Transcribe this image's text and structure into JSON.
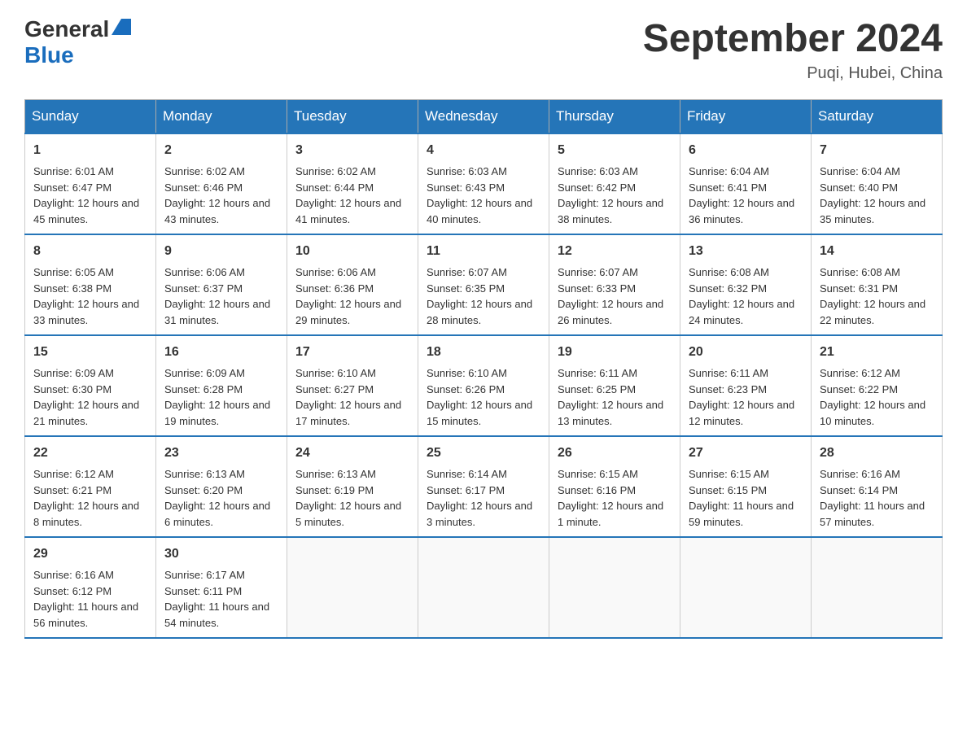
{
  "header": {
    "logo_general": "General",
    "logo_blue": "Blue",
    "title": "September 2024",
    "subtitle": "Puqi, Hubei, China"
  },
  "calendar": {
    "weekdays": [
      "Sunday",
      "Monday",
      "Tuesday",
      "Wednesday",
      "Thursday",
      "Friday",
      "Saturday"
    ],
    "weeks": [
      [
        {
          "day": "1",
          "sunrise": "Sunrise: 6:01 AM",
          "sunset": "Sunset: 6:47 PM",
          "daylight": "Daylight: 12 hours and 45 minutes."
        },
        {
          "day": "2",
          "sunrise": "Sunrise: 6:02 AM",
          "sunset": "Sunset: 6:46 PM",
          "daylight": "Daylight: 12 hours and 43 minutes."
        },
        {
          "day": "3",
          "sunrise": "Sunrise: 6:02 AM",
          "sunset": "Sunset: 6:44 PM",
          "daylight": "Daylight: 12 hours and 41 minutes."
        },
        {
          "day": "4",
          "sunrise": "Sunrise: 6:03 AM",
          "sunset": "Sunset: 6:43 PM",
          "daylight": "Daylight: 12 hours and 40 minutes."
        },
        {
          "day": "5",
          "sunrise": "Sunrise: 6:03 AM",
          "sunset": "Sunset: 6:42 PM",
          "daylight": "Daylight: 12 hours and 38 minutes."
        },
        {
          "day": "6",
          "sunrise": "Sunrise: 6:04 AM",
          "sunset": "Sunset: 6:41 PM",
          "daylight": "Daylight: 12 hours and 36 minutes."
        },
        {
          "day": "7",
          "sunrise": "Sunrise: 6:04 AM",
          "sunset": "Sunset: 6:40 PM",
          "daylight": "Daylight: 12 hours and 35 minutes."
        }
      ],
      [
        {
          "day": "8",
          "sunrise": "Sunrise: 6:05 AM",
          "sunset": "Sunset: 6:38 PM",
          "daylight": "Daylight: 12 hours and 33 minutes."
        },
        {
          "day": "9",
          "sunrise": "Sunrise: 6:06 AM",
          "sunset": "Sunset: 6:37 PM",
          "daylight": "Daylight: 12 hours and 31 minutes."
        },
        {
          "day": "10",
          "sunrise": "Sunrise: 6:06 AM",
          "sunset": "Sunset: 6:36 PM",
          "daylight": "Daylight: 12 hours and 29 minutes."
        },
        {
          "day": "11",
          "sunrise": "Sunrise: 6:07 AM",
          "sunset": "Sunset: 6:35 PM",
          "daylight": "Daylight: 12 hours and 28 minutes."
        },
        {
          "day": "12",
          "sunrise": "Sunrise: 6:07 AM",
          "sunset": "Sunset: 6:33 PM",
          "daylight": "Daylight: 12 hours and 26 minutes."
        },
        {
          "day": "13",
          "sunrise": "Sunrise: 6:08 AM",
          "sunset": "Sunset: 6:32 PM",
          "daylight": "Daylight: 12 hours and 24 minutes."
        },
        {
          "day": "14",
          "sunrise": "Sunrise: 6:08 AM",
          "sunset": "Sunset: 6:31 PM",
          "daylight": "Daylight: 12 hours and 22 minutes."
        }
      ],
      [
        {
          "day": "15",
          "sunrise": "Sunrise: 6:09 AM",
          "sunset": "Sunset: 6:30 PM",
          "daylight": "Daylight: 12 hours and 21 minutes."
        },
        {
          "day": "16",
          "sunrise": "Sunrise: 6:09 AM",
          "sunset": "Sunset: 6:28 PM",
          "daylight": "Daylight: 12 hours and 19 minutes."
        },
        {
          "day": "17",
          "sunrise": "Sunrise: 6:10 AM",
          "sunset": "Sunset: 6:27 PM",
          "daylight": "Daylight: 12 hours and 17 minutes."
        },
        {
          "day": "18",
          "sunrise": "Sunrise: 6:10 AM",
          "sunset": "Sunset: 6:26 PM",
          "daylight": "Daylight: 12 hours and 15 minutes."
        },
        {
          "day": "19",
          "sunrise": "Sunrise: 6:11 AM",
          "sunset": "Sunset: 6:25 PM",
          "daylight": "Daylight: 12 hours and 13 minutes."
        },
        {
          "day": "20",
          "sunrise": "Sunrise: 6:11 AM",
          "sunset": "Sunset: 6:23 PM",
          "daylight": "Daylight: 12 hours and 12 minutes."
        },
        {
          "day": "21",
          "sunrise": "Sunrise: 6:12 AM",
          "sunset": "Sunset: 6:22 PM",
          "daylight": "Daylight: 12 hours and 10 minutes."
        }
      ],
      [
        {
          "day": "22",
          "sunrise": "Sunrise: 6:12 AM",
          "sunset": "Sunset: 6:21 PM",
          "daylight": "Daylight: 12 hours and 8 minutes."
        },
        {
          "day": "23",
          "sunrise": "Sunrise: 6:13 AM",
          "sunset": "Sunset: 6:20 PM",
          "daylight": "Daylight: 12 hours and 6 minutes."
        },
        {
          "day": "24",
          "sunrise": "Sunrise: 6:13 AM",
          "sunset": "Sunset: 6:19 PM",
          "daylight": "Daylight: 12 hours and 5 minutes."
        },
        {
          "day": "25",
          "sunrise": "Sunrise: 6:14 AM",
          "sunset": "Sunset: 6:17 PM",
          "daylight": "Daylight: 12 hours and 3 minutes."
        },
        {
          "day": "26",
          "sunrise": "Sunrise: 6:15 AM",
          "sunset": "Sunset: 6:16 PM",
          "daylight": "Daylight: 12 hours and 1 minute."
        },
        {
          "day": "27",
          "sunrise": "Sunrise: 6:15 AM",
          "sunset": "Sunset: 6:15 PM",
          "daylight": "Daylight: 11 hours and 59 minutes."
        },
        {
          "day": "28",
          "sunrise": "Sunrise: 6:16 AM",
          "sunset": "Sunset: 6:14 PM",
          "daylight": "Daylight: 11 hours and 57 minutes."
        }
      ],
      [
        {
          "day": "29",
          "sunrise": "Sunrise: 6:16 AM",
          "sunset": "Sunset: 6:12 PM",
          "daylight": "Daylight: 11 hours and 56 minutes."
        },
        {
          "day": "30",
          "sunrise": "Sunrise: 6:17 AM",
          "sunset": "Sunset: 6:11 PM",
          "daylight": "Daylight: 11 hours and 54 minutes."
        },
        null,
        null,
        null,
        null,
        null
      ]
    ]
  }
}
